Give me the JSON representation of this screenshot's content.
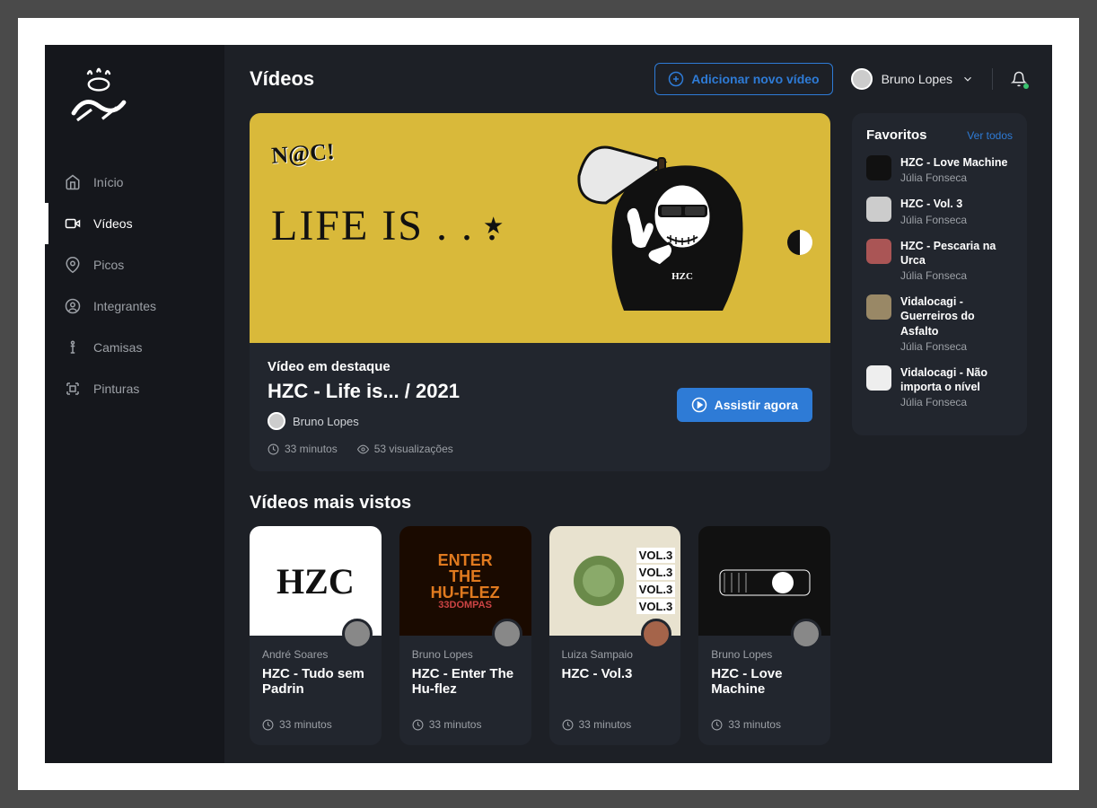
{
  "page": {
    "title": "Vídeos"
  },
  "actions": {
    "add_video": "Adicionar novo vídeo"
  },
  "user": {
    "name": "Bruno Lopes"
  },
  "sidebar": {
    "items": [
      {
        "label": "Início"
      },
      {
        "label": "Vídeos"
      },
      {
        "label": "Picos"
      },
      {
        "label": "Integrantes"
      },
      {
        "label": "Camisas"
      },
      {
        "label": "Pinturas"
      }
    ]
  },
  "featured": {
    "label": "Vídeo em destaque",
    "title": "HZC - Life is... / 2021",
    "author": "Bruno Lopes",
    "duration": "33 minutos",
    "views": "53 visualizações",
    "watch": "Assistir agora",
    "art_brand": "N@C!",
    "art_life": "LIFE IS . . ."
  },
  "favorites": {
    "title": "Favoritos",
    "all": "Ver todos",
    "items": [
      {
        "title": "HZC - Love Machine",
        "author": "Júlia Fonseca"
      },
      {
        "title": "HZC - Vol. 3",
        "author": "Júlia Fonseca"
      },
      {
        "title": "HZC - Pescaria na Urca",
        "author": "Júlia Fonseca"
      },
      {
        "title": "Vidalocagi - Guerreiros do Asfalto",
        "author": "Júlia Fonseca"
      },
      {
        "title": "Vidalocagi - Não importa o nível",
        "author": "Júlia Fonseca"
      }
    ]
  },
  "most_viewed": {
    "title": "Vídeos mais vistos",
    "items": [
      {
        "author": "André Soares",
        "title": "HZC - Tudo sem Padrin",
        "duration": "33 minutos"
      },
      {
        "author": "Bruno Lopes",
        "title": "HZC - Enter The Hu-flez",
        "duration": "33 minutos"
      },
      {
        "author": "Luiza Sampaio",
        "title": "HZC - Vol.3",
        "duration": "33 minutos"
      },
      {
        "author": "Bruno Lopes",
        "title": "HZC - Love Machine",
        "duration": "33 minutos"
      }
    ]
  },
  "card_art": {
    "enter1": "ENTER",
    "enter2": "THE",
    "enter3": "HU-FLEZ",
    "enter4": "33DOMPAS",
    "vol3": "VOL.3"
  }
}
